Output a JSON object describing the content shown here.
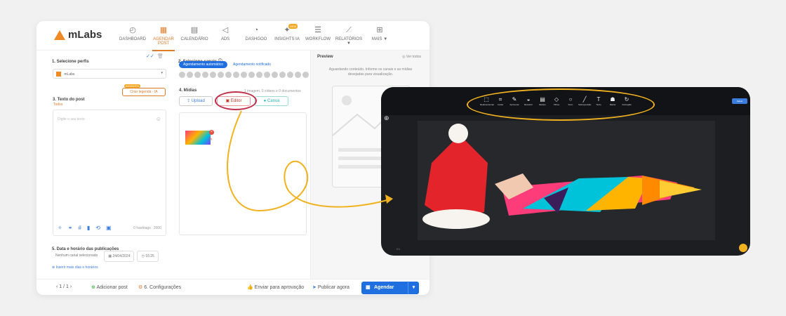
{
  "app": {
    "logo": "mLabs"
  },
  "nav": [
    {
      "label": "DASHBOARD",
      "icon": "◴",
      "active": false
    },
    {
      "label": "AGENDAR POST",
      "icon": "▦",
      "active": true
    },
    {
      "label": "CALENDÁRIO",
      "icon": "▤",
      "active": false
    },
    {
      "label": "ADS",
      "icon": "◁",
      "active": false
    },
    {
      "label": "DASHGOO",
      "icon": "◔",
      "active": false
    },
    {
      "label": "INSIGHTS IA",
      "icon": "✦",
      "active": false,
      "badge": "NEW"
    },
    {
      "label": "WORKFLOW",
      "icon": "☰",
      "active": false
    },
    {
      "label": "RELATÓRIOS ▼",
      "icon": "⟋",
      "active": false
    },
    {
      "label": "MAIS ▼",
      "icon": "⊞",
      "active": false
    }
  ],
  "left": {
    "profiles_label": "1. Selecione perfis",
    "profile_name": "mLabs",
    "text_label": "3. Texto do post",
    "tab_all": "Todos",
    "legend_badge": "INSIGHTS",
    "legend_button": "Criar legenda - IA",
    "placeholder": "Digite o seu texto",
    "hashtags": "0 hashtags",
    "char_count": "2000"
  },
  "mid": {
    "channels_label": "2. Selecione canais ⓘ",
    "tab_auto": "Agendamento automático",
    "tab_notif": "Agendamento notificado",
    "media_label": "4. Mídias",
    "media_count": "1 imagem, 0 vídeos e 0 documentos",
    "upload": "Upload",
    "editor": "Editor",
    "canva": "Canva"
  },
  "preview": {
    "title": "Preview",
    "see_all": "Ver todos",
    "message": "Aguardando conteúdo. Informe os canais e as mídias desejadas para visualização."
  },
  "date": {
    "label": "5. Data e horário das publicações",
    "no_channel": "Nenhum canal selecionado",
    "date": "24/04/2024",
    "time": "16:25",
    "add_more": "Inserir mais dias e horários"
  },
  "bottom": {
    "page": "1 / 1",
    "add_post": "Adicionar post",
    "settings": "6. Configurações",
    "approval": "Enviar para aprovação",
    "publish_now": "Publicar agora",
    "schedule": "Agendar"
  },
  "editor": {
    "save": "Salvar",
    "tools": [
      {
        "label": "Redimensionar",
        "icon": "⬚"
      },
      {
        "label": "Cortar",
        "icon": "⌗"
      },
      {
        "label": "Aprimorar",
        "icon": "✎"
      },
      {
        "label": "Recolorir",
        "icon": "◒"
      },
      {
        "label": "Efeitos",
        "icon": "▤"
      },
      {
        "label": "Filtros",
        "icon": "◇"
      },
      {
        "label": "Foco",
        "icon": "○"
      },
      {
        "label": "Sobreposição",
        "icon": "╱"
      },
      {
        "label": "Texto",
        "icon": "T"
      },
      {
        "label": "Marca",
        "icon": "☗"
      },
      {
        "label": "Animação",
        "icon": "↻"
      }
    ],
    "footer": "Ed"
  },
  "colors": {
    "accent": "#e07b2a",
    "primary": "#1f6fe0",
    "highlight": "#f2b21f",
    "ring": "#c0304a"
  }
}
